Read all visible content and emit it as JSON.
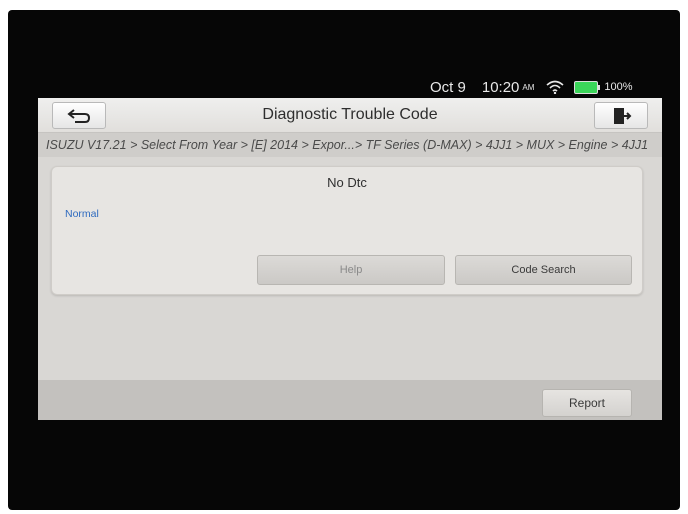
{
  "status_bar": {
    "date": "Oct 9",
    "time": "10:20",
    "ampm": "AM",
    "battery": "100%",
    "icons": [
      "wifi-icon",
      "battery-icon"
    ]
  },
  "header": {
    "title": "Diagnostic Trouble Code",
    "back_icon": "back-arrow-icon",
    "exit_icon": "exit-icon"
  },
  "breadcrumb": "ISUZU V17.21 > Select From Year > [E] 2014 > Expor...> TF Series (D-MAX) > 4JJ1 > MUX > Engine > 4JJ1",
  "result": {
    "message": "No Dtc",
    "status": "Normal",
    "status_color": "#2f6bbf"
  },
  "buttons": {
    "help": "Help",
    "code_search": "Code Search",
    "report": "Report"
  },
  "colors": {
    "battery": "#3bd65a",
    "background": "#d9d7d4"
  }
}
